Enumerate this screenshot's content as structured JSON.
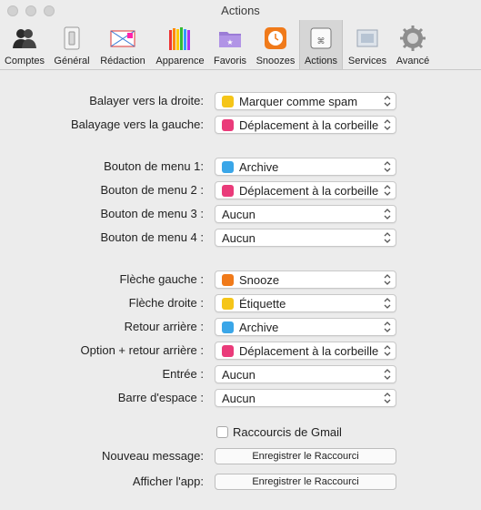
{
  "window": {
    "title": "Actions"
  },
  "toolbar": {
    "tabs": [
      {
        "label": "Comptes",
        "icon": "accounts-icon"
      },
      {
        "label": "Général",
        "icon": "general-icon"
      },
      {
        "label": "Rédaction",
        "icon": "compose-icon"
      },
      {
        "label": "Apparence",
        "icon": "appearance-icon"
      },
      {
        "label": "Favoris",
        "icon": "favorites-icon"
      },
      {
        "label": "Snoozes",
        "icon": "snoozes-icon"
      },
      {
        "label": "Actions",
        "icon": "actions-icon",
        "active": true
      },
      {
        "label": "Services",
        "icon": "services-icon"
      },
      {
        "label": "Avancé",
        "icon": "advanced-icon"
      }
    ]
  },
  "swipe": {
    "right": {
      "label": "Balayer vers la droite:",
      "value": "Marquer comme spam",
      "icon": "spam-icon",
      "color": "#f5c518"
    },
    "left": {
      "label": "Balayage vers la gauche:",
      "value": "Déplacement à la corbeille",
      "icon": "trash-icon",
      "color": "#ea3b7a"
    }
  },
  "menu_buttons": [
    {
      "label": "Bouton de menu 1:",
      "value": "Archive",
      "icon": "archive-icon",
      "color": "#3aa6e8"
    },
    {
      "label": "Bouton de menu 2 :",
      "value": "Déplacement à la corbeille",
      "icon": "trash-icon",
      "color": "#ea3b7a"
    },
    {
      "label": "Bouton de menu 3 :",
      "value": "Aucun",
      "icon": "",
      "color": ""
    },
    {
      "label": "Bouton de menu 4 :",
      "value": "Aucun",
      "icon": "",
      "color": ""
    }
  ],
  "keys": [
    {
      "label": "Flèche gauche :",
      "value": "Snooze",
      "icon": "snooze-icon",
      "color": "#f07a1a"
    },
    {
      "label": "Flèche droite :",
      "value": "Étiquette",
      "icon": "label-icon",
      "color": "#f5c518"
    },
    {
      "label": "Retour arrière :",
      "value": "Archive",
      "icon": "archive-icon",
      "color": "#3aa6e8"
    },
    {
      "label": "Option + retour arrière :",
      "value": "Déplacement à la corbeille",
      "icon": "trash-icon",
      "color": "#ea3b7a"
    },
    {
      "label": "Entrée :",
      "value": "Aucun",
      "icon": "",
      "color": ""
    },
    {
      "label": "Barre d'espace :",
      "value": "Aucun",
      "icon": "",
      "color": ""
    }
  ],
  "gmail_shortcuts": {
    "label": "Raccourcis de Gmail",
    "checked": false
  },
  "shortcuts": {
    "new_message": {
      "label": "Nouveau message:",
      "button": "Enregistrer le Raccourci"
    },
    "show_app": {
      "label": "Afficher l'app:",
      "button": "Enregistrer le Raccourci"
    }
  }
}
